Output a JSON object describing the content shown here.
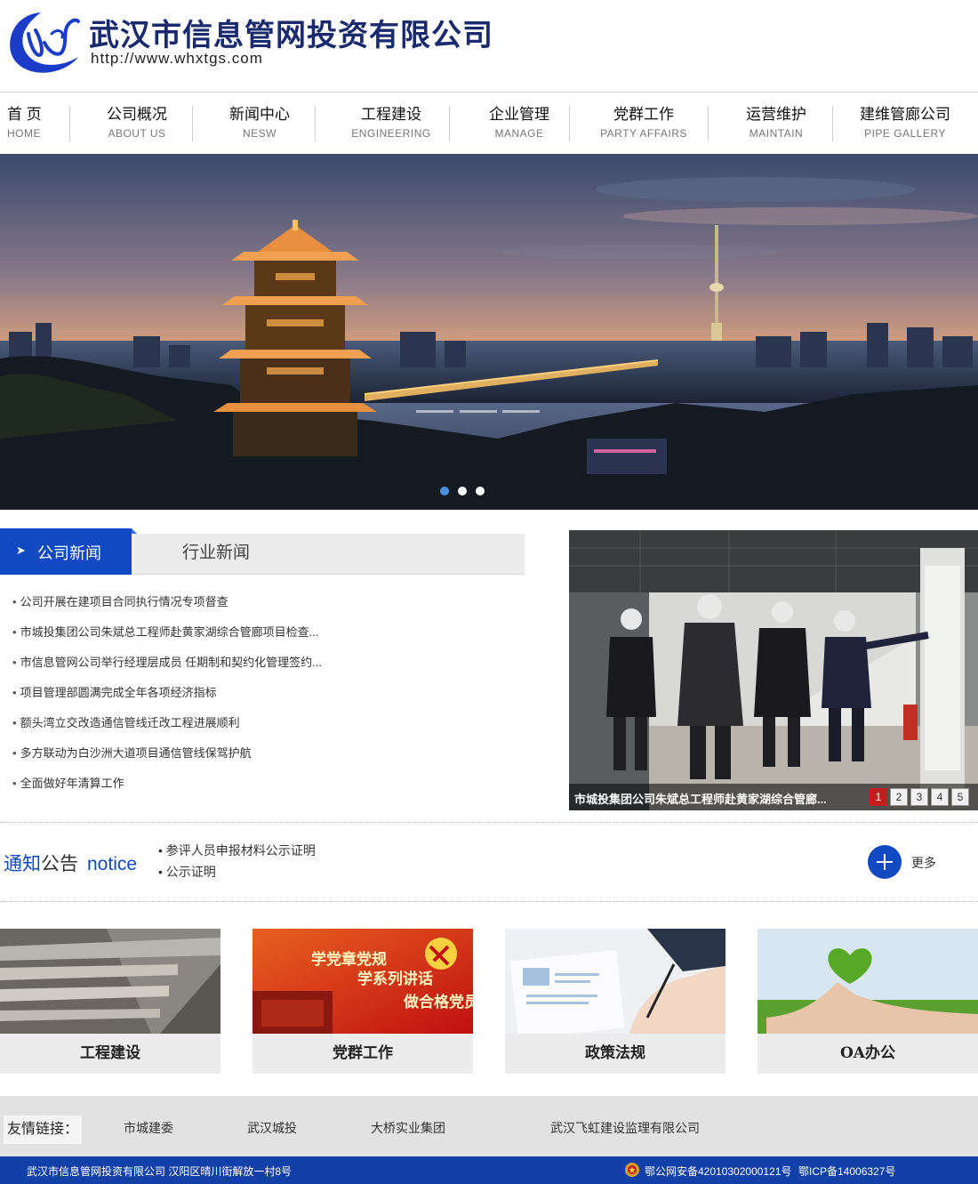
{
  "header": {
    "company_name": "武汉市信息管网投资有限公司",
    "url": "http://www.whxtgs.com"
  },
  "nav": {
    "items": [
      {
        "cn": "首 页",
        "en": "HOME"
      },
      {
        "cn": "公司概况",
        "en": "ABOUT US"
      },
      {
        "cn": "新闻中心",
        "en": "NESW"
      },
      {
        "cn": "工程建设",
        "en": "ENGINEERING"
      },
      {
        "cn": "企业管理",
        "en": "MANAGE"
      },
      {
        "cn": "党群工作",
        "en": "PARTY AFFAIRS"
      },
      {
        "cn": "运营维护",
        "en": "MAINTAIN"
      },
      {
        "cn": "建维管廊公司",
        "en": "PIPE GALLERY"
      }
    ]
  },
  "banner": {
    "slide_count": 3,
    "active_slide": 1
  },
  "news": {
    "tabs": {
      "active": "公司新闻",
      "inactive": "行业新闻"
    },
    "items": [
      "公司开展在建项目合同执行情况专项督查",
      "市城投集团公司朱斌总工程师赴黄家湖综合管廊项目检查...",
      "市信息管网公司举行经理层成员 任期制和契约化管理签约...",
      "项目管理部圆满完成全年各项经济指标",
      "额头湾立交改造通信管线迁改工程进展顺利",
      "多方联动为白沙洲大道项目通信管线保驾护航",
      "全面做好年清算工作"
    ],
    "bullet": "•",
    "photo": {
      "caption": "市城投集团公司朱斌总工程师赴黄家湖综合管廊...",
      "pages": [
        "1",
        "2",
        "3",
        "4",
        "5"
      ],
      "active_page": "1"
    }
  },
  "notice": {
    "title_part1": "通知",
    "title_part2": "公告",
    "title_part3": "notice",
    "items": [
      "参评人员申报材料公示证明",
      "公示证明"
    ],
    "more_label": "更多"
  },
  "cards": [
    {
      "label": "工程建设"
    },
    {
      "label": "党群工作"
    },
    {
      "label": "政策法规"
    },
    {
      "label": "OA办公"
    }
  ],
  "card_text": {
    "party_line1": "学党章党规",
    "party_line2": "学系列讲话",
    "party_line3": "做合格党员"
  },
  "links": {
    "label": "友情链接：",
    "items": [
      "市城建委",
      "武汉城投",
      "大桥实业集团",
      "武汉飞虹建设监理有限公司"
    ]
  },
  "footer": {
    "address": "武汉市信息管网投资有限公司  汉阳区晴川街解放一村8号",
    "police_record": "鄂公网安备42010302000121号",
    "icp": "鄂ICP备14006327号"
  },
  "colors": {
    "brand_blue": "#1049c2",
    "footer_blue": "#1040a8",
    "logo_blue": "#1a3cc8",
    "pager_active": "#c41e1e"
  }
}
